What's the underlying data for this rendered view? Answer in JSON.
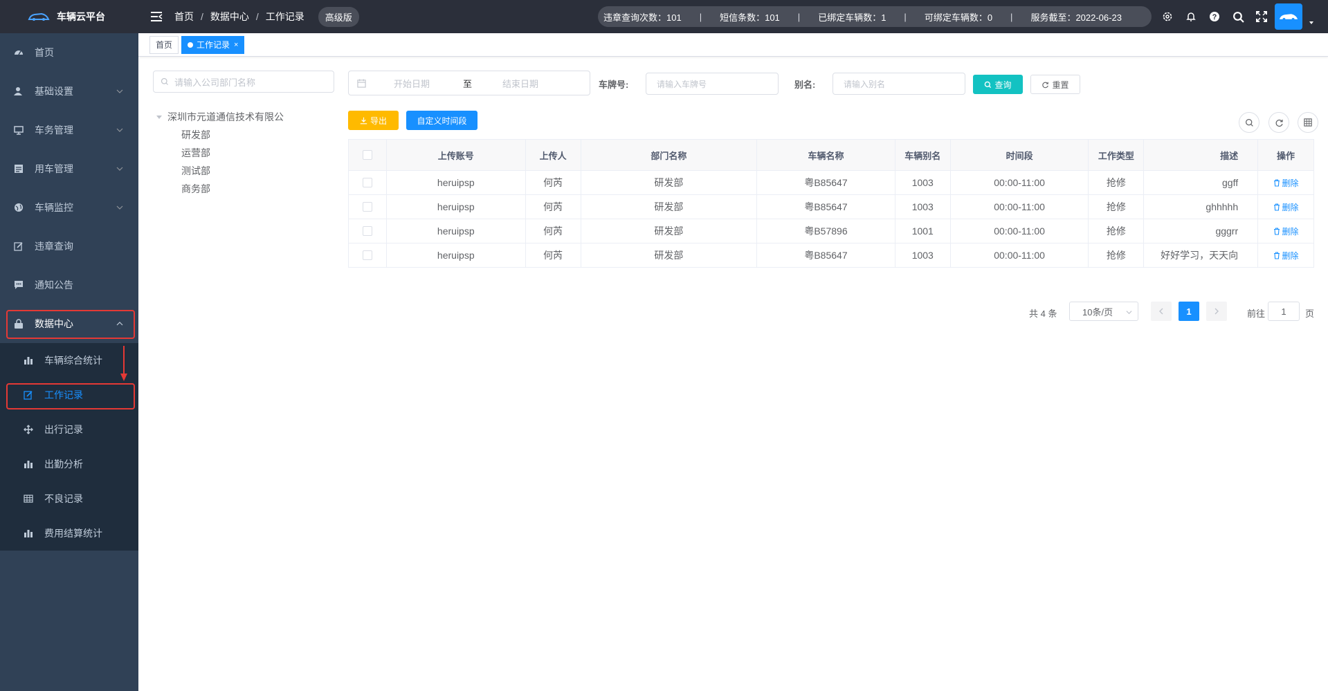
{
  "app": {
    "title": "车辆云平台"
  },
  "header": {
    "breadcrumb": [
      "首页",
      "数据中心",
      "工作记录"
    ],
    "separator": "/",
    "edition": "高级版",
    "stats": [
      "违章查询次数：101",
      "短信条数：101",
      "已绑定车辆数：1",
      "可绑定车辆数：0",
      "服务截至：2022-06-23"
    ],
    "stat_separator": "|",
    "icons": [
      "gear-icon",
      "bell-icon",
      "help-icon",
      "search-icon",
      "fullscreen-icon"
    ]
  },
  "sidebar": {
    "items": [
      {
        "label": "首页",
        "icon": "dashboard-icon",
        "has_children": false
      },
      {
        "label": "基础设置",
        "icon": "user-icon",
        "has_children": true
      },
      {
        "label": "车务管理",
        "icon": "monitor-icon",
        "has_children": true
      },
      {
        "label": "用车管理",
        "icon": "form-icon",
        "has_children": true
      },
      {
        "label": "车辆监控",
        "icon": "globe-icon",
        "has_children": true
      },
      {
        "label": "违章查询",
        "icon": "edit-icon",
        "has_children": false
      },
      {
        "label": "通知公告",
        "icon": "message-icon",
        "has_children": false
      },
      {
        "label": "数据中心",
        "icon": "lock-icon",
        "has_children": true,
        "expanded": true
      }
    ],
    "submenu": [
      {
        "label": "车辆综合统计",
        "icon": "bar-chart-icon"
      },
      {
        "label": "工作记录",
        "icon": "edit-icon",
        "current": true
      },
      {
        "label": "出行记录",
        "icon": "move-icon"
      },
      {
        "label": "出勤分析",
        "icon": "bar-chart-icon"
      },
      {
        "label": "不良记录",
        "icon": "table-icon"
      },
      {
        "label": "费用结算统计",
        "icon": "bar-chart-icon"
      }
    ]
  },
  "tags": [
    {
      "label": "首页",
      "active": false
    },
    {
      "label": "工作记录",
      "active": true,
      "close": "×"
    }
  ],
  "tree": {
    "search_placeholder": "请输入公司部门名称",
    "root": "深圳市元道通信技术有限公",
    "children": [
      "研发部",
      "运营部",
      "测试部",
      "商务部"
    ]
  },
  "filters": {
    "start_placeholder": "开始日期",
    "range_separator": "至",
    "end_placeholder": "结束日期",
    "plate_label": "车牌号:",
    "plate_placeholder": "请输入车牌号",
    "alias_label": "别名:",
    "alias_placeholder": "请输入别名",
    "search_button": "查询",
    "reset_button": "重置"
  },
  "toolbar": {
    "export_button": "导出",
    "custom_period_button": "自定义时间段"
  },
  "table": {
    "columns": [
      "上传账号",
      "上传人",
      "部门名称",
      "车辆名称",
      "车辆别名",
      "时间段",
      "工作类型",
      "描述",
      "操作"
    ],
    "delete_label": "删除",
    "rows": [
      [
        "heruipsp",
        "何芮",
        "研发部",
        "粤B85647",
        "1003",
        "00:00-11:00",
        "抢修",
        "ggff"
      ],
      [
        "heruipsp",
        "何芮",
        "研发部",
        "粤B85647",
        "1003",
        "00:00-11:00",
        "抢修",
        "ghhhhh"
      ],
      [
        "heruipsp",
        "何芮",
        "研发部",
        "粤B57896",
        "1001",
        "00:00-11:00",
        "抢修",
        "gggrr"
      ],
      [
        "heruipsp",
        "何芮",
        "研发部",
        "粤B85647",
        "1003",
        "00:00-11:00",
        "抢修",
        "好好学习，天天向"
      ]
    ]
  },
  "pagination": {
    "total": "共 4 条",
    "page_size": "10条/页",
    "current_page": "1",
    "goto_label": "前往",
    "goto_value": "1",
    "page_suffix": "页"
  },
  "colors": {
    "topbar": "#2b2f3a",
    "sidebar": "#304156",
    "submenu": "#1f2d3d",
    "primary": "#1890ff",
    "teal": "#13c2c2",
    "orange": "#ffba00",
    "highlight": "#e53935"
  }
}
